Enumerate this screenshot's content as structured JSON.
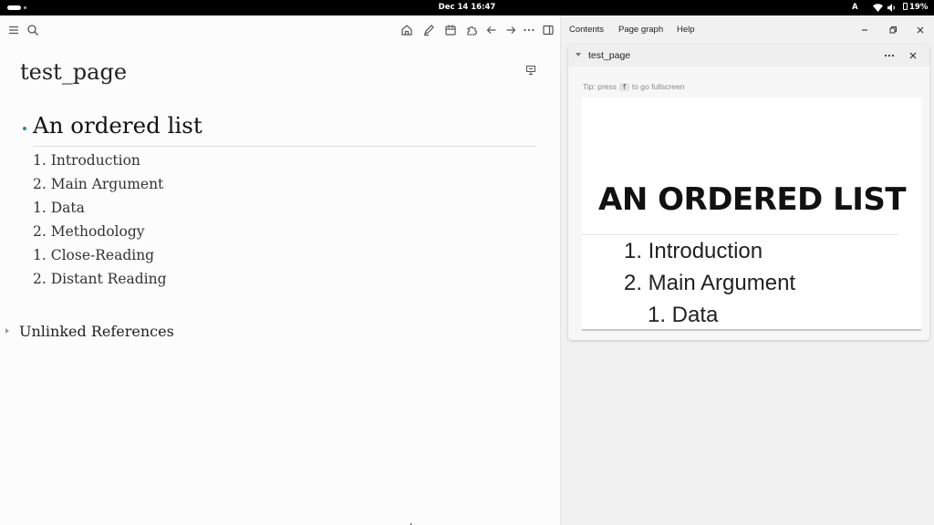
{
  "system_bar": {
    "clock": "Dec 14  16:47",
    "keyboard_layout": "A",
    "battery": "19%"
  },
  "editor": {
    "page_title": "test_page",
    "heading": "An ordered list",
    "list_items": [
      "1. Introduction",
      "2. Main Argument",
      "1. Data",
      "2. Methodology",
      "1. Close-Reading",
      "2. Distant Reading"
    ],
    "unlinked_references": "Unlinked References",
    "accent_bullet_color": "#2a8f8a"
  },
  "sidebar": {
    "nav": [
      "Contents",
      "Page graph",
      "Help"
    ],
    "card": {
      "title": "test_page",
      "tip_prefix": "Tip: press",
      "tip_key": "f",
      "tip_suffix": "to go fullscreen",
      "slide_heading": "AN ORDERED LIST",
      "slide_items": [
        "1. Introduction",
        "2. Main Argument",
        "1. Data"
      ]
    }
  },
  "icons": [
    "menu-icon",
    "search-icon",
    "home-icon",
    "journal-edit-icon",
    "calendar-icon",
    "plugin-icon",
    "back-icon",
    "forward-icon",
    "more-icon",
    "sidebar-toggle-icon",
    "presentation-icon",
    "minimize-icon",
    "maximize-icon",
    "close-icon"
  ]
}
